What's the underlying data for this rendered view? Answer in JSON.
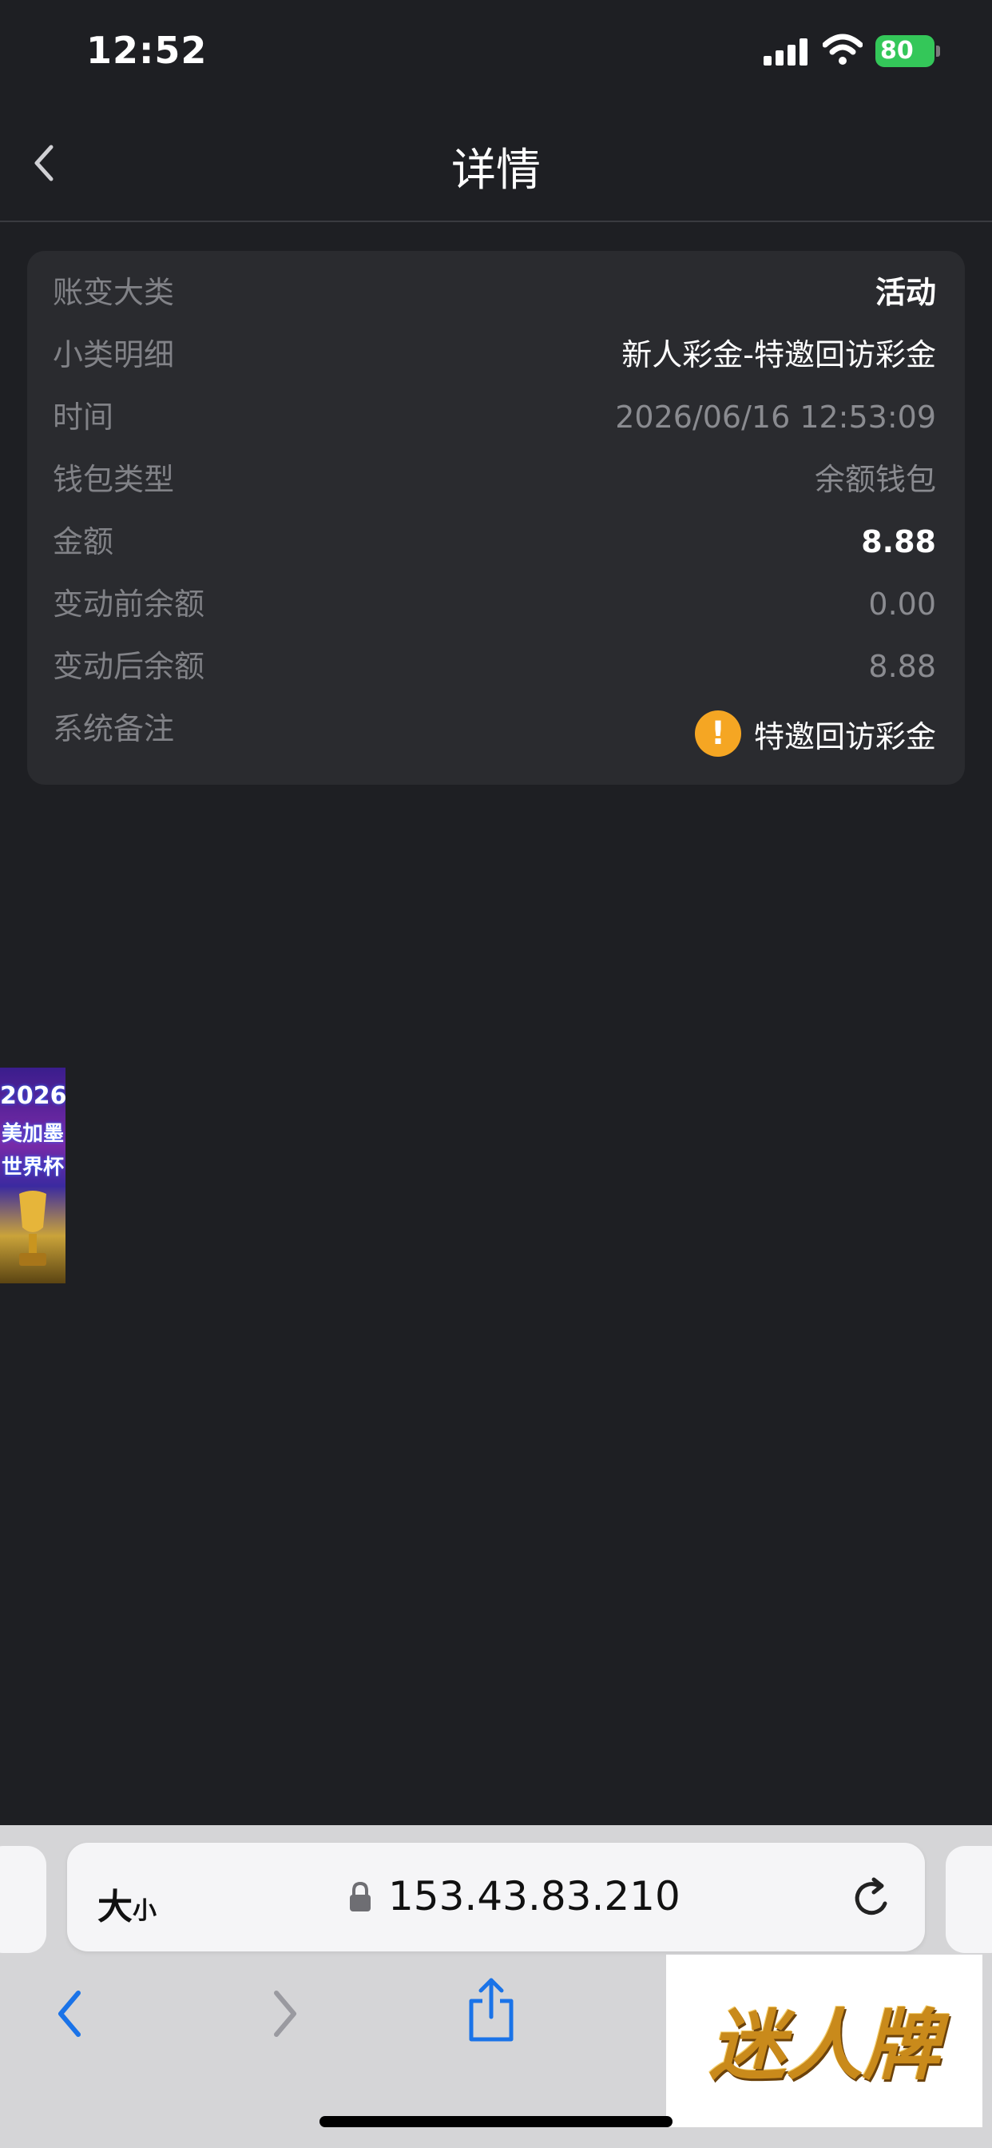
{
  "status_bar": {
    "time": "12:52",
    "battery": "80"
  },
  "header": {
    "title": "详情"
  },
  "detail": {
    "rows": [
      {
        "label": "账变大类",
        "value": "活动"
      },
      {
        "label": "小类明细",
        "value": "新人彩金-特邀回访彩金"
      },
      {
        "label": "时间",
        "value": "2026/06/16 12:53:09"
      },
      {
        "label": "钱包类型",
        "value": "余额钱包"
      },
      {
        "label": "金额",
        "value": "8.88"
      },
      {
        "label": "变动前余额",
        "value": "0.00"
      },
      {
        "label": "变动后余额",
        "value": "8.88"
      },
      {
        "label": "系统备注",
        "value": "特邀回访彩金"
      }
    ]
  },
  "banner": {
    "line1": "2026",
    "line2": "美加墨",
    "line3": "世界杯"
  },
  "browser": {
    "text_size_big": "大",
    "text_size_small": "小",
    "url": "153.43.83.210"
  },
  "logo": {
    "text": "迷人牌"
  },
  "icons": {
    "back": "chevron-left-icon",
    "warning": "exclamation-circle-icon",
    "lock": "lock-icon",
    "reload": "reload-icon",
    "share": "share-icon"
  },
  "colors": {
    "background": "#1e1f23",
    "card": "#2a2b2f",
    "label": "#818287",
    "warning": "#f5a623",
    "battery": "#34c759",
    "browser_accent": "#1a73e8"
  }
}
